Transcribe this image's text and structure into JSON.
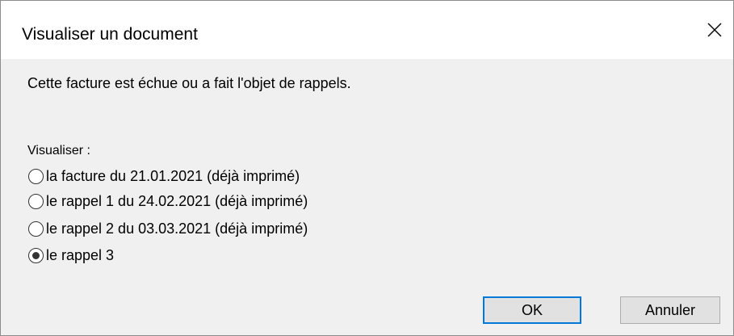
{
  "window": {
    "title": "Visualiser un document",
    "close_icon": "close-icon"
  },
  "message": "Cette facture est échue ou a fait l'objet de rappels.",
  "options_group": {
    "label": "Visualiser :",
    "options": [
      {
        "label": "la facture du 21.01.2021 (déjà imprimé)",
        "selected": false
      },
      {
        "label": "le rappel 1 du 24.02.2021 (déjà imprimé)",
        "selected": false
      },
      {
        "label": "le rappel 2 du 03.03.2021 (déjà imprimé)",
        "selected": false
      },
      {
        "label": "le rappel 3",
        "selected": true
      }
    ]
  },
  "buttons": {
    "ok_label": "OK",
    "cancel_label": "Annuler"
  },
  "colors": {
    "titlebar": "#ffffff",
    "body": "#f0f0f0",
    "button_face": "#e1e1e1",
    "default_button_border": "#0078d7"
  }
}
